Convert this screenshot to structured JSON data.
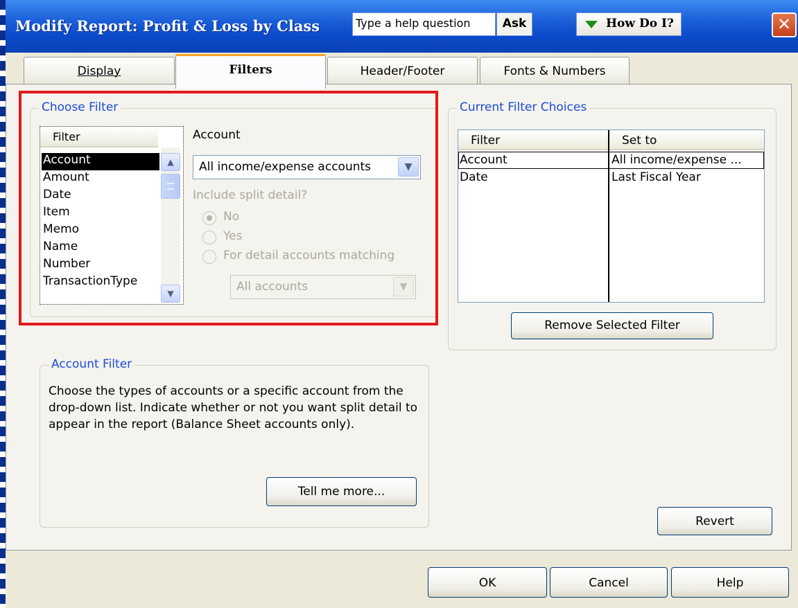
{
  "window": {
    "title": "Modify Report: Profit & Loss by Class",
    "help_placeholder": "Type a help question",
    "ask_label": "Ask",
    "howdoi_label": "How Do I?",
    "close_glyph": "✕"
  },
  "tabs": [
    {
      "label": "Display",
      "active": false
    },
    {
      "label": "Filters",
      "active": true
    },
    {
      "label": "Header/Footer",
      "active": false
    },
    {
      "label": "Fonts & Numbers",
      "active": false
    }
  ],
  "choose_filter": {
    "legend": "Choose Filter",
    "list_header": "Filter",
    "items": [
      "Account",
      "Amount",
      "Date",
      "Item",
      "Memo",
      "Name",
      "Number",
      "TransactionType"
    ],
    "selected": "Account",
    "account_label": "Account",
    "account_value": "All income/expense accounts",
    "split_label": "Include split detail?",
    "radio_no": "No",
    "radio_yes": "Yes",
    "radio_matching": "For detail accounts matching",
    "matching_value": "All accounts"
  },
  "current_filters": {
    "legend": "Current Filter Choices",
    "col_filter": "Filter",
    "col_set_to": "Set to",
    "rows": [
      {
        "filter": "Account",
        "set_to": "All income/expense ..."
      },
      {
        "filter": "Date",
        "set_to": "Last Fiscal Year"
      }
    ],
    "remove_button": "Remove Selected Filter"
  },
  "account_filter": {
    "legend": "Account Filter",
    "description": "Choose the types of accounts or a specific account from the drop-down list. Indicate whether or not you want split detail to appear in the report (Balance Sheet accounts only).",
    "tell_me_more": "Tell me more..."
  },
  "buttons": {
    "revert": "Revert",
    "ok": "OK",
    "cancel": "Cancel",
    "help": "Help"
  },
  "icons": {
    "scroll_up": "▲",
    "scroll_down": "▼",
    "dropdown": "▼"
  },
  "colors": {
    "titlebar": "#0a49c9",
    "highlight_box": "#e41a1a",
    "legend_text": "#1b4cd6",
    "active_tab_accent": "#f6a524"
  }
}
